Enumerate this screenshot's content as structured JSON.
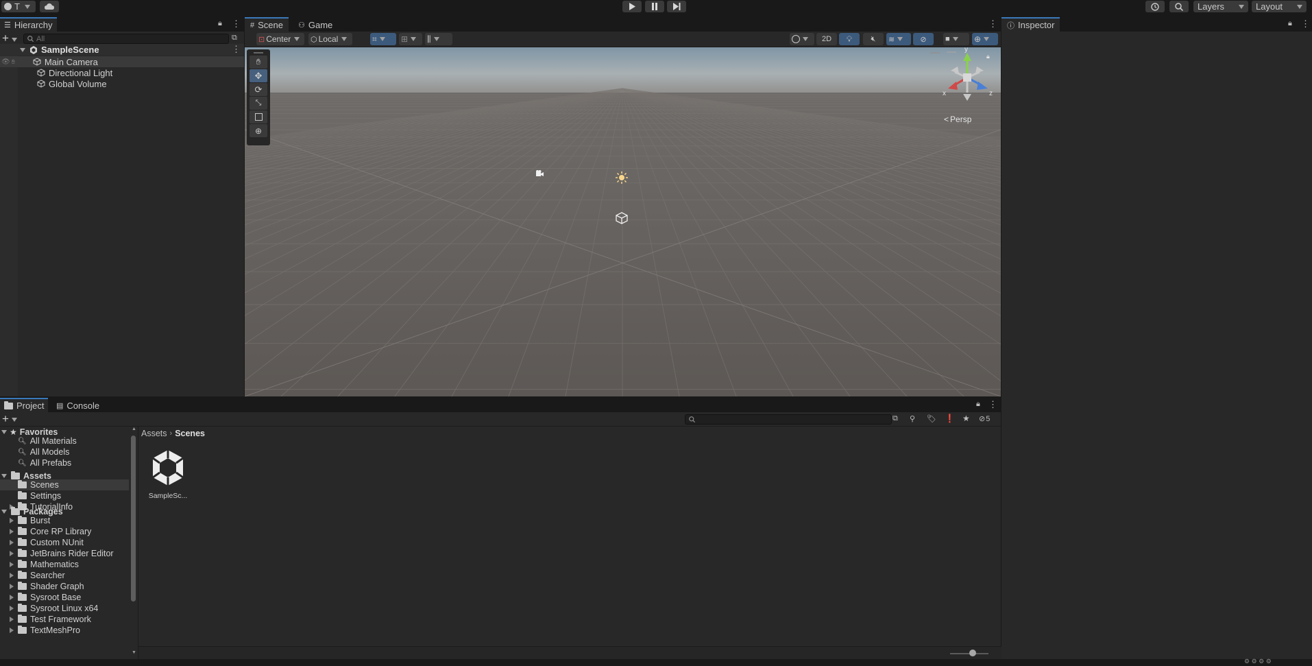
{
  "topbar": {
    "account_label": "T",
    "layers_label": "Layers",
    "layout_label": "Layout"
  },
  "hierarchy": {
    "tab_label": "Hierarchy",
    "search_placeholder": "All",
    "scene_name": "SampleScene",
    "items": [
      "Main Camera",
      "Directional Light",
      "Global Volume"
    ]
  },
  "scene_view": {
    "tabs": [
      "Scene",
      "Game"
    ],
    "pivot_label": "Center",
    "space_label": "Local",
    "mode_2d_label": "2D",
    "projection_label": "Persp",
    "gizmo_axes": {
      "x": "x",
      "y": "y",
      "z": "z"
    }
  },
  "inspector": {
    "tab_label": "Inspector"
  },
  "project": {
    "tabs": [
      "Project",
      "Console"
    ],
    "hidden_count": "5",
    "favorites_label": "Favorites",
    "favorites": [
      "All Materials",
      "All Models",
      "All Prefabs"
    ],
    "assets_label": "Assets",
    "assets": [
      "Scenes",
      "Settings",
      "TutorialInfo"
    ],
    "packages_label": "Packages",
    "packages": [
      "Burst",
      "Core RP Library",
      "Custom NUnit",
      "JetBrains Rider Editor",
      "Mathematics",
      "Searcher",
      "Shader Graph",
      "Sysroot Base",
      "Sysroot Linux x64",
      "Test Framework",
      "TextMeshPro"
    ],
    "breadcrumb": [
      "Assets",
      "Scenes"
    ],
    "files": [
      "SampleSc..."
    ]
  },
  "colors": {
    "accent": "#3a79bb",
    "panel": "#282828",
    "background": "#191919"
  }
}
